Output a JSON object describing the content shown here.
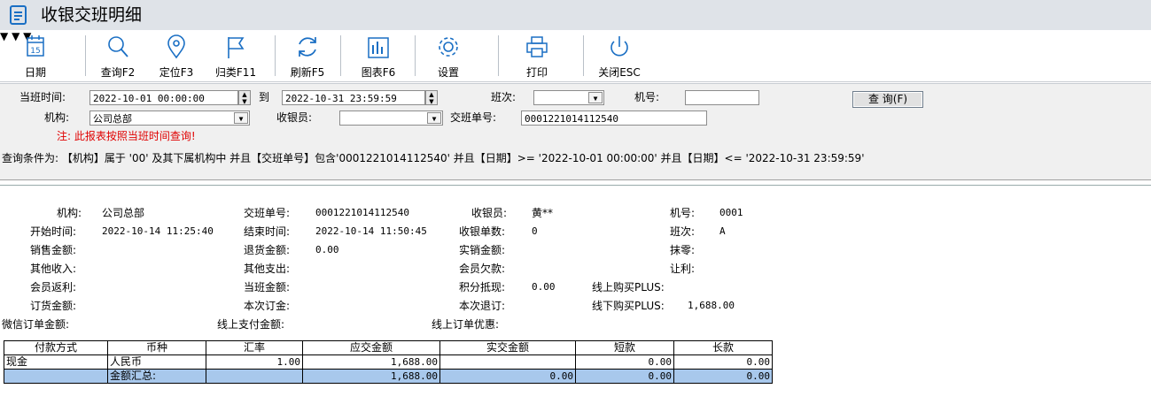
{
  "window": {
    "title": "收银交班明细",
    "icon": "document-icon"
  },
  "toolbar": {
    "date_label": "日期",
    "calendar_day": "15",
    "query_label": "查询F2",
    "locate_label": "定位F3",
    "classify_label": "归类F11",
    "refresh_label": "刷新F5",
    "chart_label": "图表F6",
    "settings_label": "设置",
    "print_label": "打印",
    "close_label": "关闭ESC"
  },
  "filter": {
    "shift_time_label": "当班时间:",
    "start_time": "2022-10-01 00:00:00",
    "to_label": "到",
    "end_time": "2022-10-31 23:59:59",
    "shift_label": "班次:",
    "shift_value": "",
    "machine_label": "机号:",
    "machine_value": "",
    "query_button": "查 询(F)",
    "org_label": "机构:",
    "org_value": "公司总部",
    "cashier_label": "收银员:",
    "cashier_value": "",
    "handover_no_label": "交班单号:",
    "handover_no_value": "0001221014112540",
    "note": "注: 此报表按照当班时间查询!"
  },
  "condition_text": "查询条件为: 【机构】属于 '00' 及其下属机构中 并且【交班单号】包含'0001221014112540' 并且【日期】>= '2022-10-01 00:00:00' 并且【日期】<= '2022-10-31 23:59:59'",
  "report": {
    "org_label": "机构:",
    "org": "公司总部",
    "handover_no_label": "交班单号:",
    "handover_no": "0001221014112540",
    "cashier_label": "收银员:",
    "cashier": "黄**",
    "machine_label": "机号:",
    "machine": "0001",
    "start_label": "开始时间:",
    "start": "2022-10-14 11:25:40",
    "end_label": "结束时间:",
    "end": "2022-10-14 11:50:45",
    "count_label": "收银单数:",
    "count": "0",
    "shift_label": "班次:",
    "shift": "A",
    "sales_label": "销售金额:",
    "sales": "",
    "refund_label": "退货金额:",
    "refund": "0.00",
    "net_sales_label": "实销金额:",
    "net_sales": "",
    "rounding_label": "抹零:",
    "rounding": "",
    "other_income_label": "其他收入:",
    "other_income": "",
    "other_expense_label": "其他支出:",
    "other_expense": "",
    "member_debt_label": "会员欠款:",
    "member_debt": "",
    "discount_label": "让利:",
    "discount": "",
    "member_rebate_label": "会员返利:",
    "member_rebate": "",
    "shift_amount_label": "当班金额:",
    "shift_amount": "",
    "points_label": "积分抵现:",
    "points": "0.00",
    "online_plus_label": "线上购买PLUS:",
    "online_plus": "",
    "order_amount_label": "订货金额:",
    "order_amount": "",
    "this_order_label": "本次订金:",
    "this_order": "",
    "this_refund_label": "本次退订:",
    "this_refund": "",
    "offline_plus_label": "线下购买PLUS:",
    "offline_plus": "1,688.00",
    "wechat_label": "微信订单金额:",
    "wechat": "",
    "online_pay_label": "线上支付金额:",
    "online_pay": "",
    "online_discount_label": "线上订单优惠:",
    "online_discount": ""
  },
  "payment_table": {
    "headers": [
      "付款方式",
      "币种",
      "汇率",
      "应交金额",
      "实交金额",
      "短款",
      "长款"
    ],
    "rows": [
      [
        "现金",
        "人民币",
        "1.00",
        "1,688.00",
        "",
        "0.00",
        "0.00"
      ]
    ],
    "summary": {
      "label": "金额汇总:",
      "due": "1,688.00",
      "actual": "0.00",
      "short": "0.00",
      "over": "0.00"
    }
  }
}
